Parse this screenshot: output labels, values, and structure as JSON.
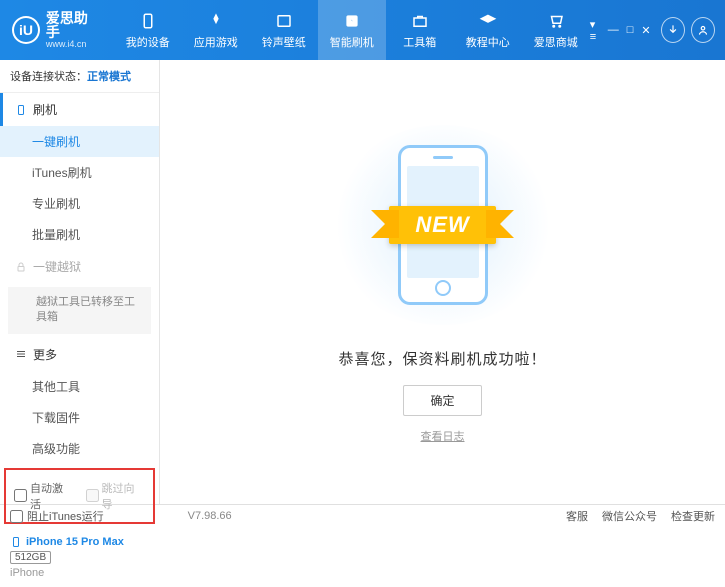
{
  "brand": {
    "name": "爱思助手",
    "url": "www.i4.cn",
    "logo_letter": "iU"
  },
  "nav": {
    "items": [
      {
        "label": "我的设备"
      },
      {
        "label": "应用游戏"
      },
      {
        "label": "铃声壁纸"
      },
      {
        "label": "智能刷机"
      },
      {
        "label": "工具箱"
      },
      {
        "label": "教程中心"
      },
      {
        "label": "爱思商城"
      }
    ]
  },
  "status": {
    "label": "设备连接状态：",
    "mode": "正常模式"
  },
  "sidebar": {
    "flash": {
      "title": "刷机",
      "items": [
        "一键刷机",
        "iTunes刷机",
        "专业刷机",
        "批量刷机"
      ]
    },
    "jailbreak": {
      "title": "一键越狱",
      "note": "越狱工具已转移至工具箱"
    },
    "more": {
      "title": "更多",
      "items": [
        "其他工具",
        "下载固件",
        "高级功能"
      ]
    },
    "checkboxes": {
      "auto_activate": "自动激活",
      "skip_guide": "跳过向导"
    }
  },
  "device": {
    "name": "iPhone 15 Pro Max",
    "storage": "512GB",
    "type": "iPhone"
  },
  "content": {
    "ribbon": "NEW",
    "message": "恭喜您，保资料刷机成功啦！",
    "confirm": "确定",
    "log_link": "查看日志"
  },
  "footer": {
    "block_itunes": "阻止iTunes运行",
    "version": "V7.98.66",
    "links": [
      "客服",
      "微信公众号",
      "检查更新"
    ]
  }
}
